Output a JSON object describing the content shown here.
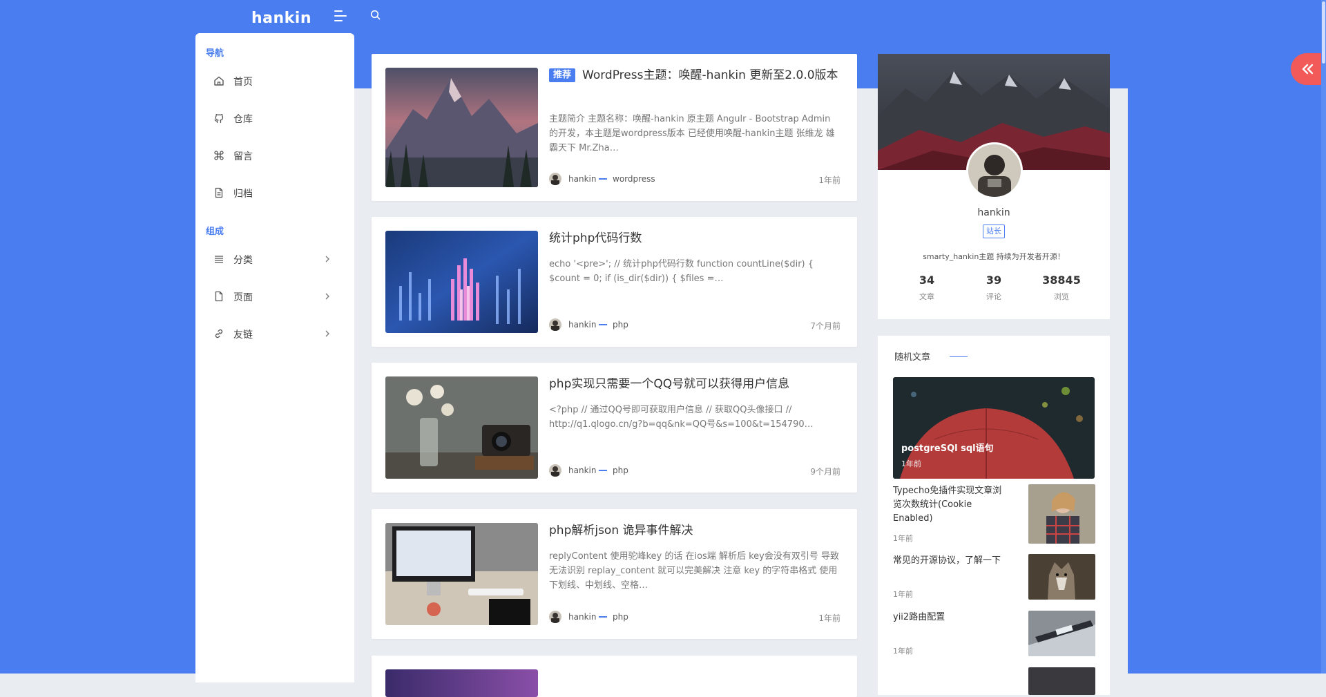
{
  "brand": "hankin",
  "sidebar": {
    "nav_title": "导航",
    "nav_items": [
      {
        "label": "首页",
        "icon": "home-icon"
      },
      {
        "label": "仓库",
        "icon": "github-icon"
      },
      {
        "label": "留言",
        "icon": "command-icon"
      },
      {
        "label": "归档",
        "icon": "file-icon"
      }
    ],
    "group_title": "组成",
    "group_items": [
      {
        "label": "分类",
        "icon": "list-icon"
      },
      {
        "label": "页面",
        "icon": "page-icon"
      },
      {
        "label": "友链",
        "icon": "link-icon"
      }
    ]
  },
  "posts": [
    {
      "badge": "推荐",
      "title": "WordPress主题：唤醒-hankin 更新至2.0.0版本",
      "excerpt": "主题简介 主题名称：唤醒-hankin 原主题 Angulr - Bootstrap Admin 的开发，本主题是wordpress版本 已经使用唤醒-hankin主题 张维龙 雄霸天下 Mr.Zha…",
      "author": "hankin",
      "category": "wordpress",
      "time": "1年前"
    },
    {
      "badge": "",
      "title": "统计php代码行数",
      "excerpt": "echo '<pre>'; // 统计php代码行数 function countLine($dir) { $count = 0; if (is_dir($dir)) { $files =…",
      "author": "hankin",
      "category": "php",
      "time": "7个月前"
    },
    {
      "badge": "",
      "title": "php实现只需要一个QQ号就可以获得用户信息",
      "excerpt": "<?php // 通过QQ号即可获取用户信息 // 获取QQ头像接口 // http://q1.qlogo.cn/g?b=qq&nk=QQ号&s=100&t=154790…",
      "author": "hankin",
      "category": "php",
      "time": "9个月前"
    },
    {
      "badge": "",
      "title": "php解析json 诡异事件解决",
      "excerpt": "replyContent 使用驼峰key 的话 在ios端 解析后 key会没有双引号 导致无法识别 replay_content 就可以完美解决 注意 key 的字符串格式 使用下划线、中划线、空格…",
      "author": "hankin",
      "category": "php",
      "time": "1年前"
    }
  ],
  "profile": {
    "name": "hankin",
    "role": "站长",
    "bio": "smarty_hankin主题 持续为开发者开源！",
    "stats": [
      {
        "num": "34",
        "label": "文章"
      },
      {
        "num": "39",
        "label": "评论"
      },
      {
        "num": "38845",
        "label": "浏览"
      }
    ]
  },
  "random": {
    "title": "随机文章",
    "featured": {
      "title": "postgreSQl sql语句",
      "time": "1年前"
    },
    "items": [
      {
        "title": "Typecho免插件实现文章浏览次数统计(Cookie Enabled)",
        "time": "1年前"
      },
      {
        "title": "常见的开源协议，了解一下",
        "time": "1年前"
      },
      {
        "title": "yii2路由配置",
        "time": "1年前"
      }
    ]
  },
  "colors": {
    "accent": "#4a7ef0",
    "back_button": "#f25a5a",
    "page_bg": "#e9ecf1"
  }
}
